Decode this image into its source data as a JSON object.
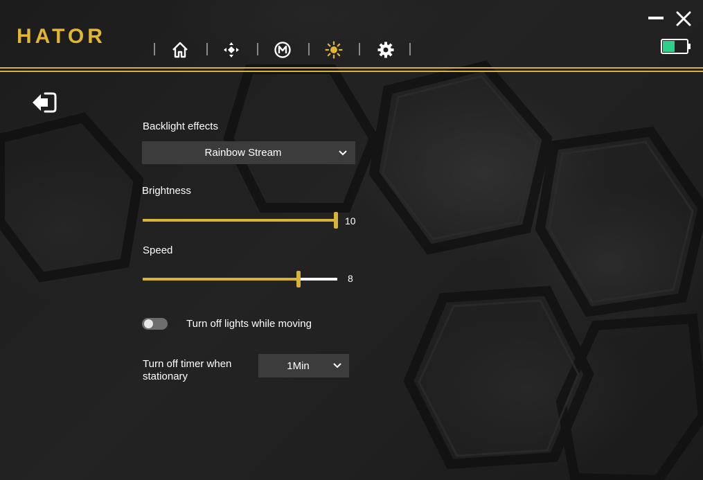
{
  "app": {
    "brand": "HATOR"
  },
  "nav": {
    "items": [
      {
        "icon": "home-icon",
        "active": false
      },
      {
        "icon": "dpi-icon",
        "active": false
      },
      {
        "icon": "macro-icon",
        "active": false
      },
      {
        "icon": "lighting-icon",
        "active": true
      },
      {
        "icon": "settings-icon",
        "active": false
      }
    ],
    "active_color": "#e3b631"
  },
  "window": {
    "battery_level": 0.5,
    "battery_color": "#2ecf8a"
  },
  "lighting": {
    "backlight_label": "Backlight effects",
    "backlight_value": "Rainbow Stream",
    "brightness_label": "Brightness",
    "brightness_value": "10",
    "brightness_max": 10,
    "speed_label": "Speed",
    "speed_value": "8",
    "speed_max": 10,
    "toggle_label": "Turn off lights while moving",
    "toggle_on": false,
    "timer_label_line1": "Turn off timer when",
    "timer_label_line2": "stationary",
    "timer_value": "1Min"
  },
  "colors": {
    "accent": "#d9b23a",
    "background": "#1a1a1a",
    "control": "#3c3c3c"
  }
}
